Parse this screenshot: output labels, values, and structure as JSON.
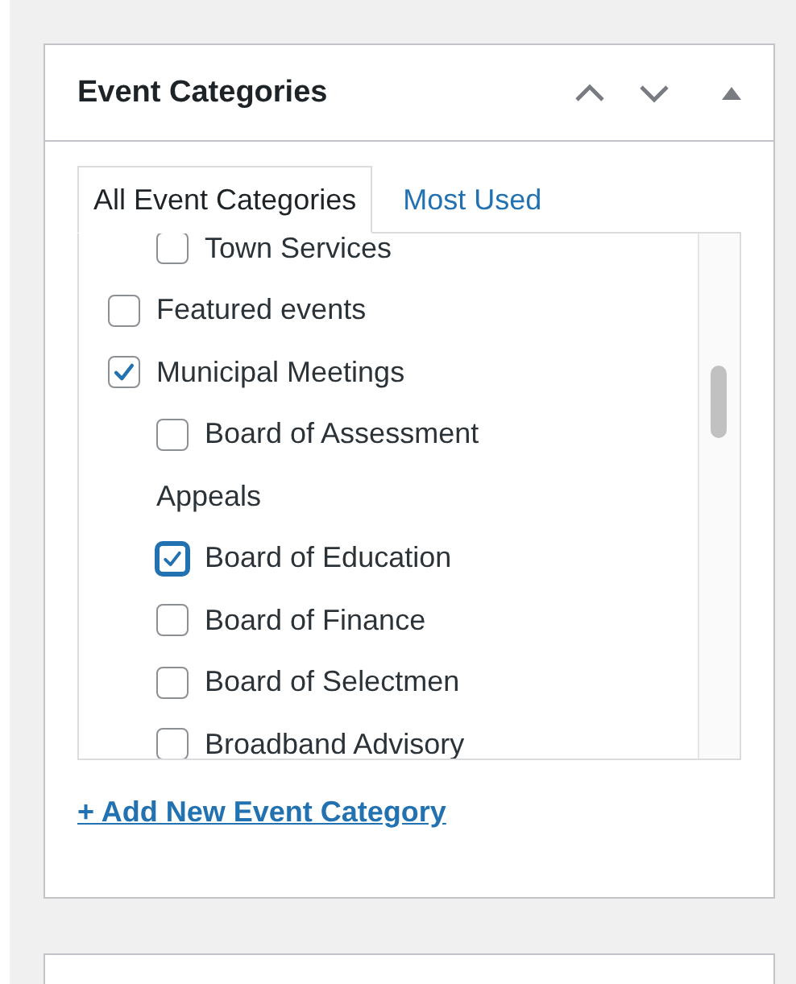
{
  "panel": {
    "title": "Event Categories"
  },
  "tabs": [
    {
      "label": "All Event Categories",
      "selected": true
    },
    {
      "label": "Most Used",
      "selected": false
    }
  ],
  "categories": [
    {
      "children": [
        {
          "label": "Town Services",
          "checked": false,
          "focused": false
        }
      ]
    },
    {
      "label": "Featured events",
      "checked": false,
      "focused": false
    },
    {
      "label": "Municipal Meetings",
      "checked": true,
      "focused": false,
      "children": [
        {
          "label": "Board of Assessment",
          "label_wrap": "Appeals",
          "checked": false,
          "focused": false
        },
        {
          "label": "Board of Education",
          "checked": true,
          "focused": true
        },
        {
          "label": "Board of Finance",
          "checked": false,
          "focused": false
        },
        {
          "label": "Board of Selectmen",
          "checked": false,
          "focused": false
        },
        {
          "label": "Broadband Advisory",
          "checked": false,
          "focused": false
        }
      ]
    }
  ],
  "add_link": "+ Add New Event Category"
}
